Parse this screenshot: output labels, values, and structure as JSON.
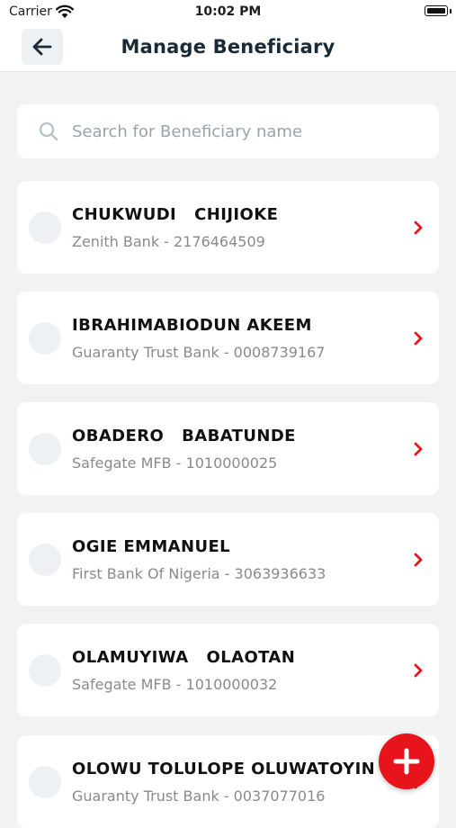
{
  "status_bar": {
    "carrier": "Carrier",
    "time": "10:02 PM"
  },
  "header": {
    "title": "Manage Beneficiary",
    "back_icon": "arrow-left-icon"
  },
  "search": {
    "placeholder": "Search for Beneficiary name",
    "value": "",
    "icon": "search-icon"
  },
  "beneficiaries": [
    {
      "name": "CHUKWUDI   CHIJIOKE",
      "detail": "Zenith Bank - 2176464509"
    },
    {
      "name": "IBRAHIMABIODUN AKEEM",
      "detail": "Guaranty Trust Bank - 0008739167"
    },
    {
      "name": "OBADERO   BABATUNDE",
      "detail": "Safegate MFB - 1010000025"
    },
    {
      "name": "OGIE EMMANUEL",
      "detail": "First Bank Of Nigeria - 3063936633"
    },
    {
      "name": "OLAMUYIWA   OLAOTAN",
      "detail": "Safegate MFB - 1010000032"
    },
    {
      "name": "OLOWU TOLULOPE OLUWATOYIN",
      "detail": "Guaranty Trust Bank - 0037077016"
    }
  ],
  "fab": {
    "icon": "plus-icon"
  },
  "colors": {
    "accent": "#e8141b",
    "background": "#f2f2f2",
    "card": "#ffffff",
    "title": "#1c2a35"
  }
}
